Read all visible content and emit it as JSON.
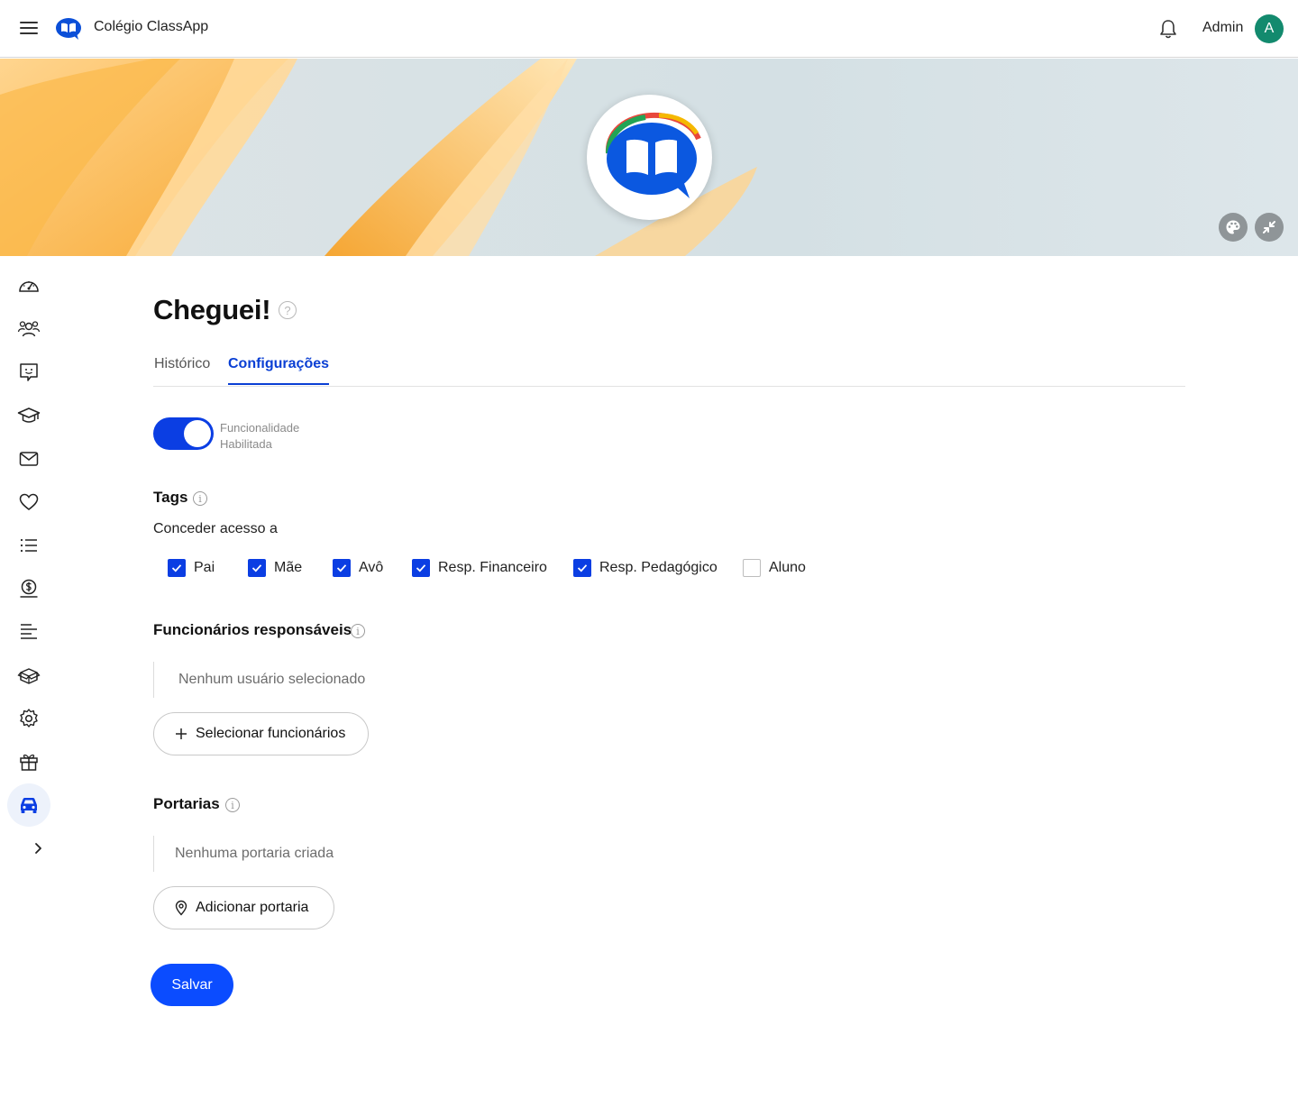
{
  "header": {
    "brand_name": "Colégio ClassApp",
    "user_name": "Admin",
    "avatar_initial": "A",
    "icons": [
      "menu-icon",
      "classapp-logo",
      "bell-icon"
    ]
  },
  "banner": {
    "buttons": [
      "palette-icon",
      "collapse-icon"
    ]
  },
  "sidebar": {
    "items": [
      "dashboard-icon",
      "users-icon",
      "chat-icon",
      "graduation-cap-icon",
      "mail-icon",
      "heart-icon",
      "list-icon",
      "money-icon",
      "align-left-icon",
      "box-icon",
      "gear-icon",
      "gift-icon",
      "car-icon",
      "chevron-right-icon"
    ],
    "active": "car-icon"
  },
  "page": {
    "title": "Cheguei!",
    "help_symbol": "?",
    "tabs": [
      {
        "label": "Histórico",
        "active": false
      },
      {
        "label": "Configurações",
        "active": true
      }
    ]
  },
  "feature_toggle": {
    "enabled": true,
    "label_line1": "Funcionalidade",
    "label_line2": "Habilitada"
  },
  "tags": {
    "title": "Tags",
    "info_symbol": "i",
    "grant_label": "Conceder acesso a",
    "options": [
      {
        "label": "Pai",
        "checked": true
      },
      {
        "label": "Mãe",
        "checked": true
      },
      {
        "label": "Avô",
        "checked": true
      },
      {
        "label": "Resp. Financeiro",
        "checked": true
      },
      {
        "label": "Resp. Pedagógico",
        "checked": true
      },
      {
        "label": "Aluno",
        "checked": false
      }
    ]
  },
  "staff": {
    "title": "Funcionários responsáveis",
    "info_symbol": "i",
    "empty_text": "Nenhum usuário selecionado",
    "button_label": "Selecionar funcionários"
  },
  "gates": {
    "title": "Portarias",
    "info_symbol": "i",
    "empty_text": "Nenhuma portaria criada",
    "button_label": "Adicionar portaria"
  },
  "actions": {
    "save_label": "Salvar"
  },
  "colors": {
    "primary": "#0b3ee3",
    "save_button": "#0b4cff",
    "avatar": "#138a6e"
  }
}
